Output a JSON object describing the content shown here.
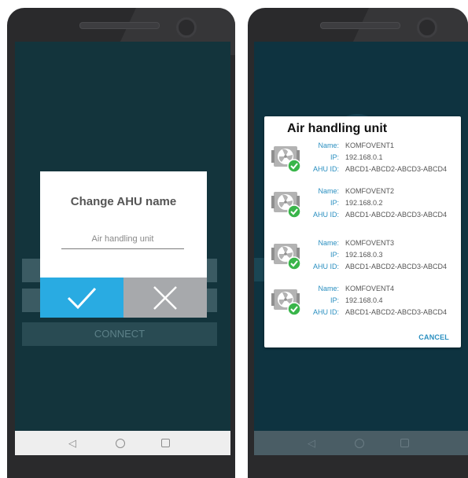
{
  "left_phone": {
    "form": {
      "connect_label": "CONNECT"
    },
    "dialog": {
      "title": "Change AHU name",
      "name_placeholder": "Air handling unit",
      "ok_icon": "check-icon",
      "cancel_icon": "close-icon"
    }
  },
  "right_phone": {
    "dialog": {
      "title": "Air handling unit",
      "labels": {
        "name": "Name:",
        "ip": "IP:",
        "ahu_id": "AHU ID:"
      },
      "units": [
        {
          "name": "KOMFOVENT1",
          "ip": "192.168.0.1",
          "ahu_id": "ABCD1-ABCD2-ABCD3-ABCD4"
        },
        {
          "name": "KOMFOVENT2",
          "ip": "192.168.0.2",
          "ahu_id": "ABCD1-ABCD2-ABCD3-ABCD4"
        },
        {
          "name": "KOMFOVENT3",
          "ip": "192.168.0.3",
          "ahu_id": "ABCD1-ABCD2-ABCD3-ABCD4"
        },
        {
          "name": "KOMFOVENT4",
          "ip": "192.168.0.4",
          "ahu_id": "ABCD1-ABCD2-ABCD3-ABCD4"
        }
      ],
      "unit_icon": "fan-unit-icon",
      "status_icon": "check-circle-icon",
      "cancel_label": "CANCEL"
    }
  },
  "navbar": {
    "back_icon": "back-triangle-icon",
    "home_icon": "home-circle-icon",
    "recents_icon": "recents-square-icon"
  },
  "colors": {
    "accent_blue": "#29abe2",
    "cancel_gray": "#a7a9ac",
    "label_blue": "#2a8fc0",
    "status_green": "#39b54a"
  }
}
